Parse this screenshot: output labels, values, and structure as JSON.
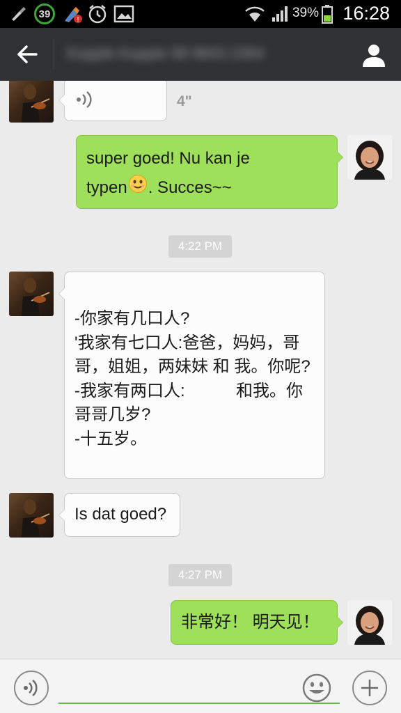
{
  "status_bar": {
    "notification_count": "39",
    "battery_percent": "39%",
    "time": "16:28",
    "icons": [
      "cleaner-icon",
      "notification-badge-icon",
      "app-update-icon",
      "alarm-icon",
      "image-icon",
      "wifi-icon",
      "signal-icon",
      "battery-icon"
    ]
  },
  "header": {
    "contact_name": "Kopple Koppie 08 9843 2364",
    "back_icon": "back-arrow-icon",
    "profile_icon": "person-icon"
  },
  "messages": [
    {
      "direction": "in",
      "type": "voice",
      "duration": "4\""
    },
    {
      "direction": "out",
      "type": "text",
      "lines": [
        "super goed! Nu kan je",
        "typen",
        ". Succes~~"
      ],
      "emoji": "smile-emoji"
    },
    {
      "type": "timestamp",
      "text": "4:22 PM"
    },
    {
      "direction": "in",
      "type": "text",
      "text": "-你家有几口人?\n'我家有七口人:爸爸，妈妈，哥哥，姐姐，两妹妹 和 我。你呢?\n-我家有两口人:           和我。你哥哥几岁?\n-十五岁。"
    },
    {
      "direction": "in",
      "type": "text",
      "text": "Is dat goed?"
    },
    {
      "type": "timestamp",
      "text": "4:27 PM"
    },
    {
      "direction": "out",
      "type": "text",
      "text": "非常好！ 明天见！"
    }
  ],
  "input_bar": {
    "voice_icon": "voice-icon",
    "emoji_icon": "emoji-icon",
    "add_icon": "plus-icon",
    "input_value": ""
  },
  "colors": {
    "outgoing_bubble": "#9fe05a",
    "incoming_bubble": "#fcfcfc",
    "header_bg": "#2f3133",
    "input_underline": "#5fbf3a"
  }
}
